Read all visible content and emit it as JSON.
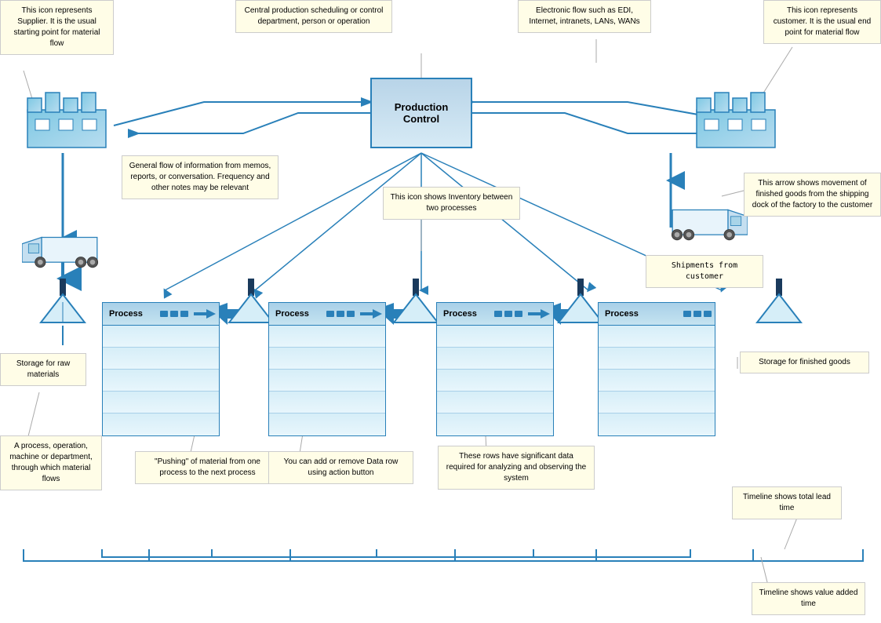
{
  "callouts": {
    "supplier_desc": "This icon represents Supplier. It is the usual starting point for material flow",
    "prod_control_desc": "Central production scheduling or control department, person or operation",
    "electronic_flow": "Electronic flow such as EDI, Internet, intranets, LANs, WANs",
    "customer_desc": "This icon represents customer. It is the usual end point for material flow",
    "info_flow": "General flow of information from memos, reports, or conversation. Frequency and other notes may be relevant",
    "inventory_desc": "This icon shows Inventory between two processes",
    "movement_desc": "This arrow shows movement of finished goods from the shipping dock of the factory to the customer",
    "shipments": "Shipments from customer",
    "storage_raw": "Storage for raw materials",
    "process_desc": "A process, operation, machine or department, through which material flows",
    "push_arrow": "\"Pushing\" of material from one process to the next process",
    "data_row": "You can add or remove Data row using action button",
    "data_significant": "These rows have significant data required for analyzing and observing the system",
    "storage_finished": "Storage for finished goods",
    "timeline_lead": "Timeline shows total lead time",
    "timeline_value": "Timeline shows value added time"
  },
  "prod_control_label": "Production\nControl",
  "processes": [
    {
      "label": "Process"
    },
    {
      "label": "Process"
    },
    {
      "label": "Process"
    },
    {
      "label": "Process"
    }
  ],
  "colors": {
    "blue_dark": "#1a6b9c",
    "blue_mid": "#2980b9",
    "blue_light": "#d6eef8",
    "callout_bg": "#fffde7",
    "callout_border": "#c8c890"
  }
}
